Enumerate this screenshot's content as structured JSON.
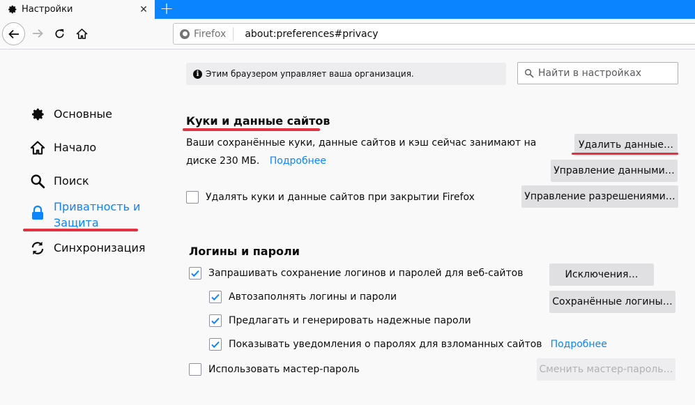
{
  "tab": {
    "title": "Настройки",
    "icon": "gear-icon"
  },
  "navbar": {
    "identity_label": "Firefox",
    "url": "about:preferences#privacy"
  },
  "sidebar": {
    "items": [
      {
        "label": "Основные",
        "icon": "gear-icon",
        "selected": false
      },
      {
        "label": "Начало",
        "icon": "home-icon",
        "selected": false
      },
      {
        "label": "Поиск",
        "icon": "search-icon",
        "selected": false
      },
      {
        "label": "Приватность и\nЗащита",
        "label_line1": "Приватность и",
        "label_line2": "Защита",
        "icon": "lock-icon",
        "selected": true
      },
      {
        "label": "Синхронизация",
        "icon": "sync-icon",
        "selected": false
      }
    ]
  },
  "policy_notice": "Этим браузером управляет ваша организация.",
  "search": {
    "placeholder": "Найти в настройках"
  },
  "cookies": {
    "title": "Куки и данные сайтов",
    "description_line1": "Ваши сохранённые куки, данные сайтов и кэш сейчас занимают на",
    "description_line2": "диске 230 МБ.",
    "learn_more": "Подробнее",
    "clear_button": "Удалить данные…",
    "manage_button": "Управление данными…",
    "permissions_button": "Управление разрешениями…",
    "delete_on_close": {
      "label": "Удалять куки и данные сайтов при закрытии Firefox",
      "checked": false
    }
  },
  "logins": {
    "title": "Логины и пароли",
    "ask_save": {
      "label": "Запрашивать сохранение логинов и паролей для веб-сайтов",
      "checked": true
    },
    "autofill": {
      "label": "Автозаполнять логины и пароли",
      "checked": true
    },
    "suggest": {
      "label": "Предлагать и генерировать надежные пароли",
      "checked": true
    },
    "breach_alerts": {
      "label": "Показывать уведомления о паролях для взломанных сайтов",
      "checked": true
    },
    "breach_learn_more": "Подробнее",
    "master_password": {
      "label": "Использовать мастер-пароль",
      "checked": false
    },
    "exceptions_button": "Исключения…",
    "saved_logins_button": "Сохранённые логины…",
    "change_master_button": "Сменить мастер-пароль…"
  },
  "colors": {
    "accent": "#0a84ff",
    "annotation": "#e0323f",
    "button": "#e0e0e2"
  }
}
